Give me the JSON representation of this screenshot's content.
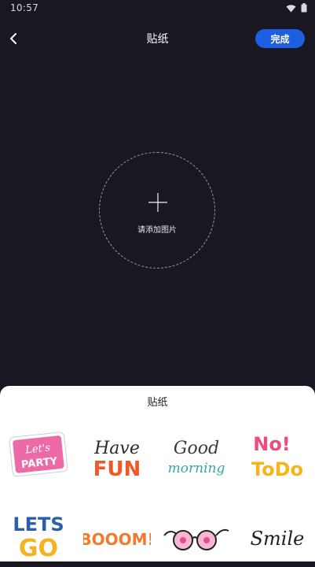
{
  "status_bar": {
    "time": "10:57"
  },
  "nav": {
    "title": "贴纸",
    "done_label": "完成"
  },
  "add_image": {
    "label": "请添加图片"
  },
  "sheet": {
    "title": "贴纸",
    "stickers": [
      {
        "name": "lets-party",
        "lines": [
          "Let's",
          "PARTY"
        ]
      },
      {
        "name": "have-fun",
        "lines": [
          "Have",
          "FUN"
        ]
      },
      {
        "name": "good-morning",
        "lines": [
          "Good",
          "morning"
        ]
      },
      {
        "name": "no-todo",
        "lines": [
          "No!",
          "ToDo"
        ]
      },
      {
        "name": "lets-go",
        "lines": [
          "LETS",
          "GO"
        ]
      },
      {
        "name": "booom",
        "lines": [
          "BOOOM!"
        ]
      },
      {
        "name": "glasses",
        "lines": []
      },
      {
        "name": "smile",
        "lines": [
          "Smile"
        ]
      }
    ]
  },
  "colors": {
    "background": "#181722",
    "accent": "#1d5fe0",
    "sheet": "#ffffff"
  }
}
